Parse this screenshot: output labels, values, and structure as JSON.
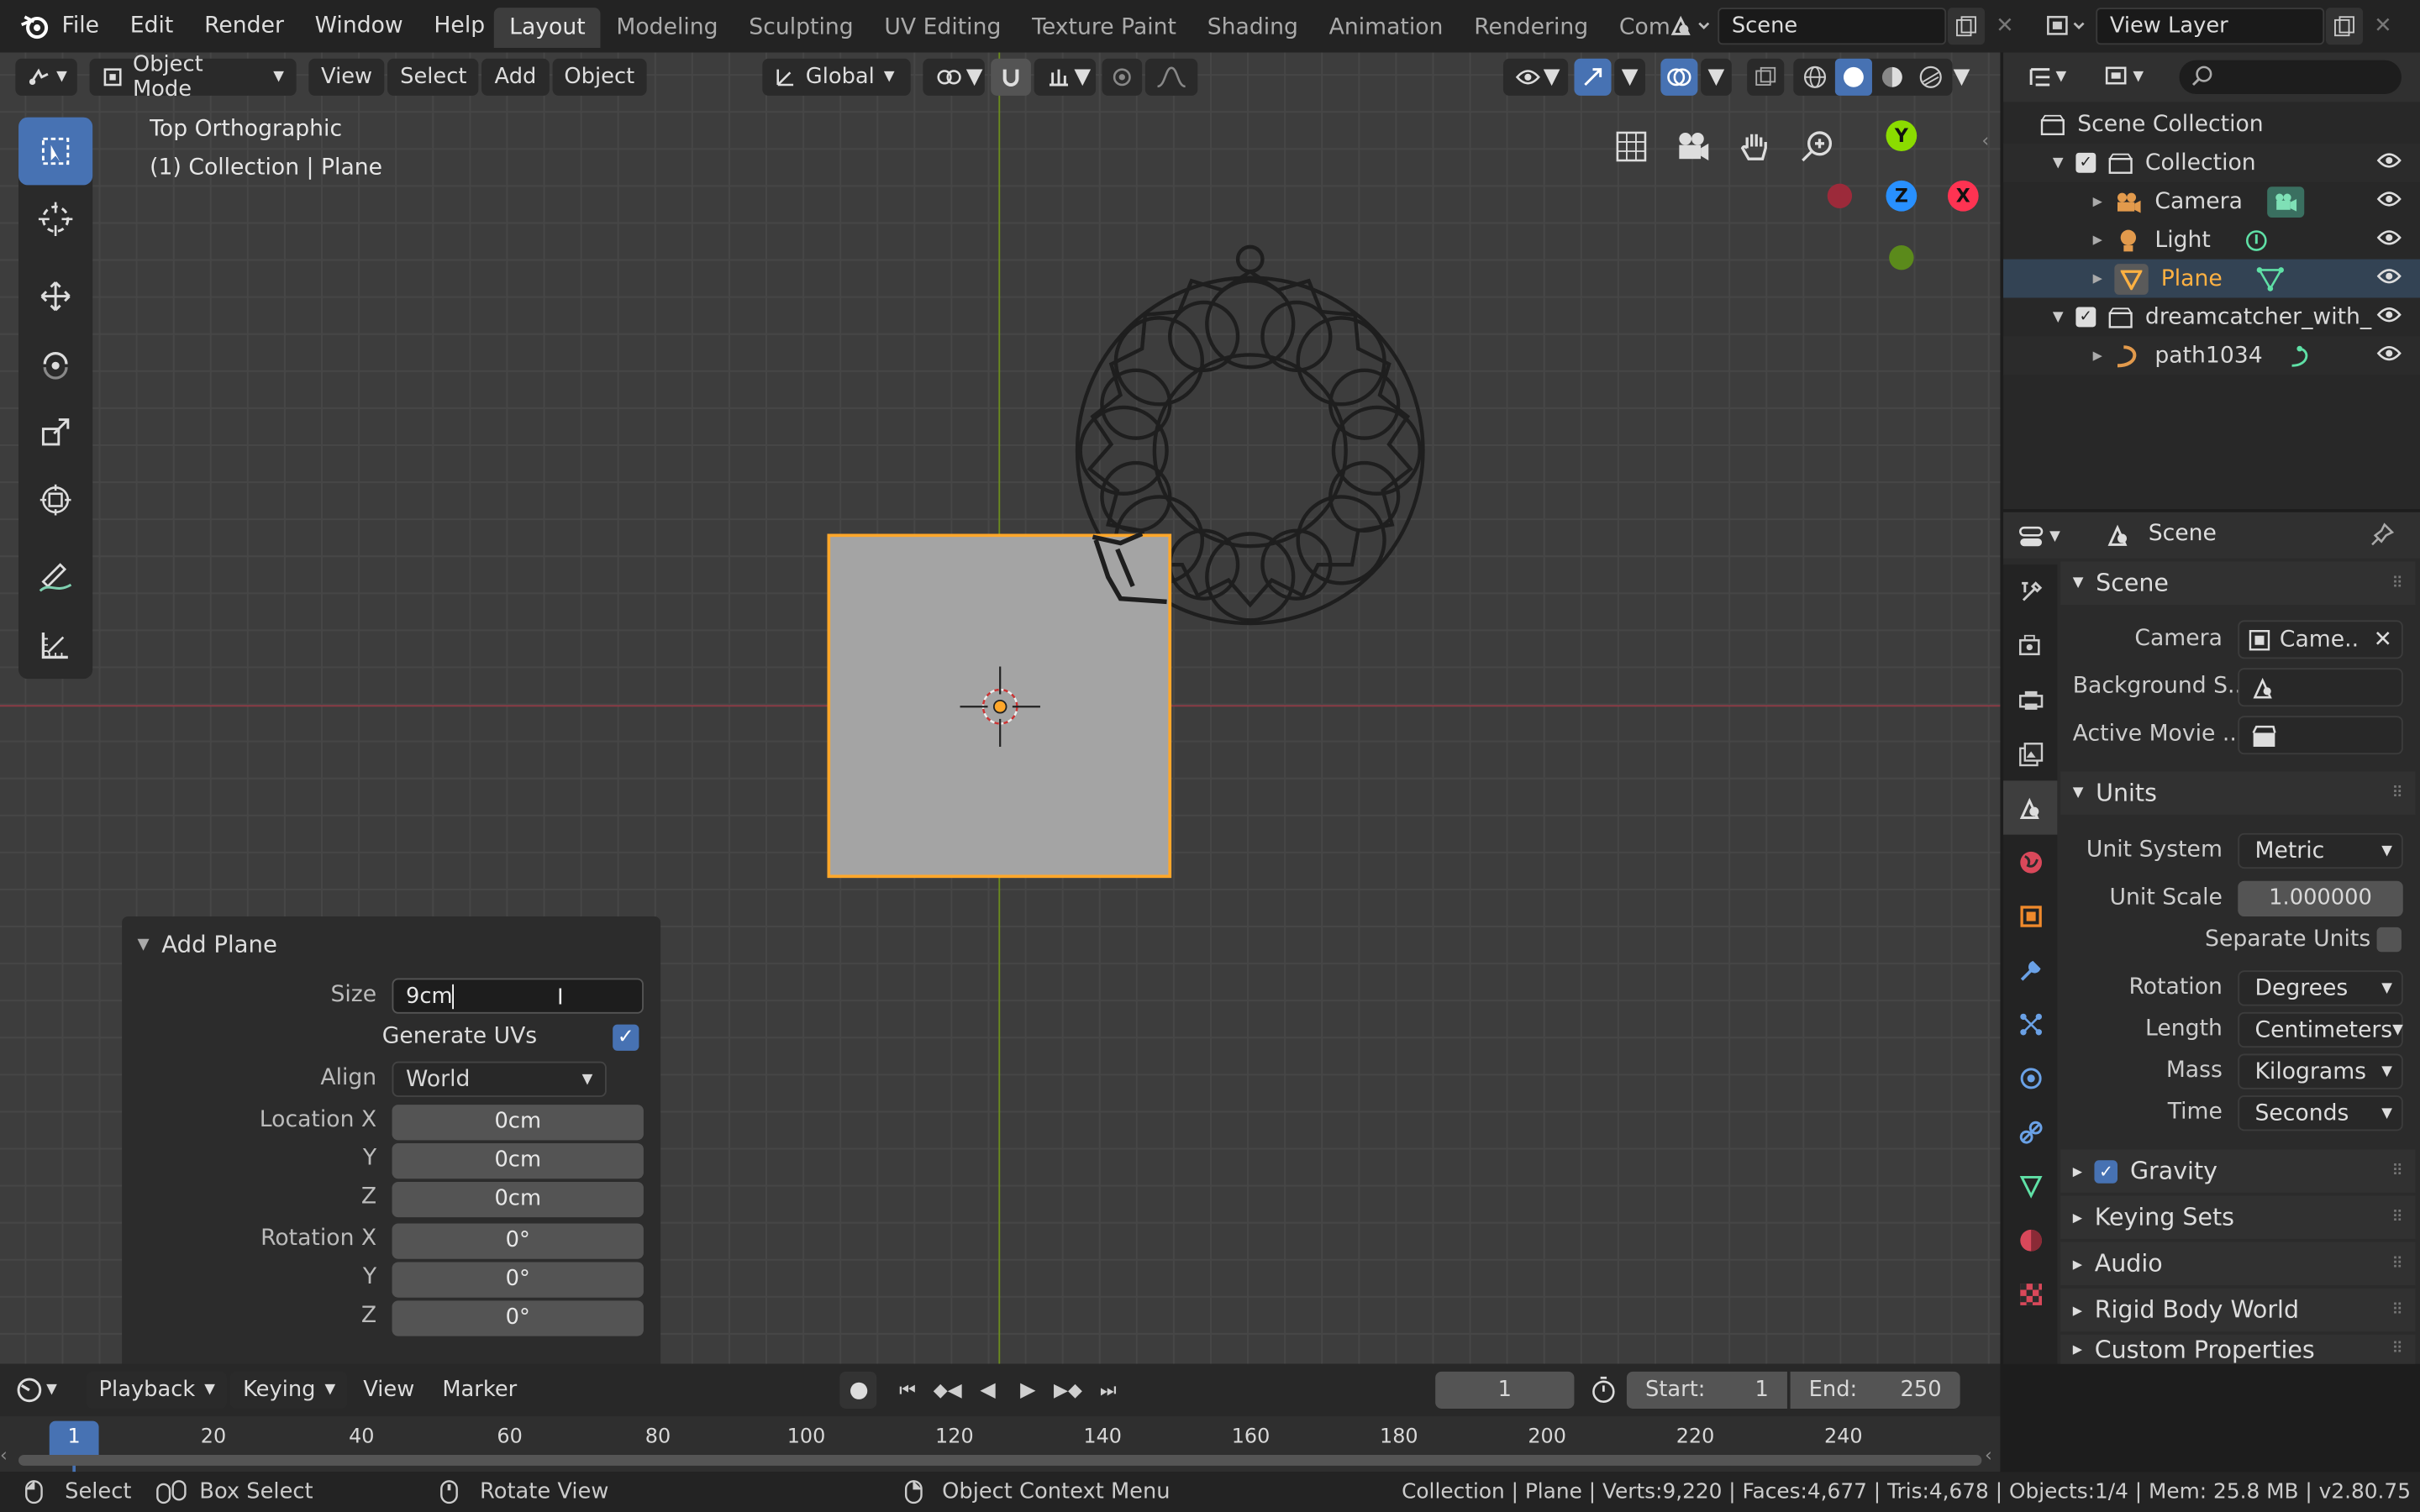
{
  "topbar": {
    "menus": [
      "File",
      "Edit",
      "Render",
      "Window",
      "Help"
    ],
    "workspaces": [
      "Layout",
      "Modeling",
      "Sculpting",
      "UV Editing",
      "Texture Paint",
      "Shading",
      "Animation",
      "Rendering",
      "Com"
    ],
    "active_workspace": "Layout",
    "scene_name": "Scene",
    "view_layer": "View Layer"
  },
  "viewport_header": {
    "mode": "Object Mode",
    "menus": [
      "View",
      "Select",
      "Add",
      "Object"
    ],
    "transform_orientation": "Global"
  },
  "viewport": {
    "view_name": "Top Orthographic",
    "collection_info": "(1) Collection | Plane",
    "gizmo": {
      "y": "Y",
      "z": "Z",
      "x": "X"
    }
  },
  "add_plane": {
    "title": "Add Plane",
    "size_label": "Size",
    "size_value": "9cm",
    "generate_uvs_label": "Generate UVs",
    "generate_uvs": true,
    "align_label": "Align",
    "align_value": "World",
    "location_label": "Location X",
    "loc_y_label": "Y",
    "loc_z_label": "Z",
    "location": [
      "0cm",
      "0cm",
      "0cm"
    ],
    "rotation_label": "Rotation X",
    "rot_y_label": "Y",
    "rot_z_label": "Z",
    "rotation": [
      "0°",
      "0°",
      "0°"
    ]
  },
  "outliner": {
    "scene_collection": "Scene Collection",
    "items": [
      {
        "label": "Collection"
      },
      {
        "label": "Camera"
      },
      {
        "label": "Light"
      },
      {
        "label": "Plane"
      },
      {
        "label": "dreamcatcher_with_"
      },
      {
        "label": "path1034"
      }
    ]
  },
  "properties": {
    "context": "Scene",
    "scene_section": "Scene",
    "camera_label": "Camera",
    "camera_value": "Came..",
    "background_label": "Background S..",
    "active_clip_label": "Active Movie ..",
    "units_section": "Units",
    "unit_system_label": "Unit System",
    "unit_system": "Metric",
    "unit_scale_label": "Unit Scale",
    "unit_scale": "1.000000",
    "separate_units_label": "Separate Units",
    "rotation_label": "Rotation",
    "rotation": "Degrees",
    "length_label": "Length",
    "length": "Centimeters",
    "mass_label": "Mass",
    "mass": "Kilograms",
    "time_label": "Time",
    "time": "Seconds",
    "gravity_section": "Gravity",
    "keying_section": "Keying Sets",
    "audio_section": "Audio",
    "rigid_section": "Rigid Body World",
    "custom_section": "Custom Properties"
  },
  "timeline": {
    "menus": [
      "Playback",
      "Keying",
      "View",
      "Marker"
    ],
    "current_frame": "1",
    "start_label": "Start:",
    "start": "1",
    "end_label": "End:",
    "end": "250",
    "ruler": [
      "1",
      "20",
      "40",
      "60",
      "80",
      "100",
      "120",
      "140",
      "160",
      "180",
      "200",
      "220",
      "240"
    ]
  },
  "statusbar": {
    "select": "Select",
    "box_select": "Box Select",
    "rotate_view": "Rotate View",
    "context_menu": "Object Context Menu",
    "stats": "Collection | Plane | Verts:9,220 | Faces:4,677 | Tris:4,678 | Objects:1/4 | Mem: 25.8 MB | v2.80.75"
  },
  "colors": {
    "accent": "#4772b3",
    "selection": "#ffa72a",
    "active_object": "#ffb142",
    "axis_x": "#ff3352",
    "axis_y": "#8bdc00",
    "axis_z": "#2890ff"
  }
}
